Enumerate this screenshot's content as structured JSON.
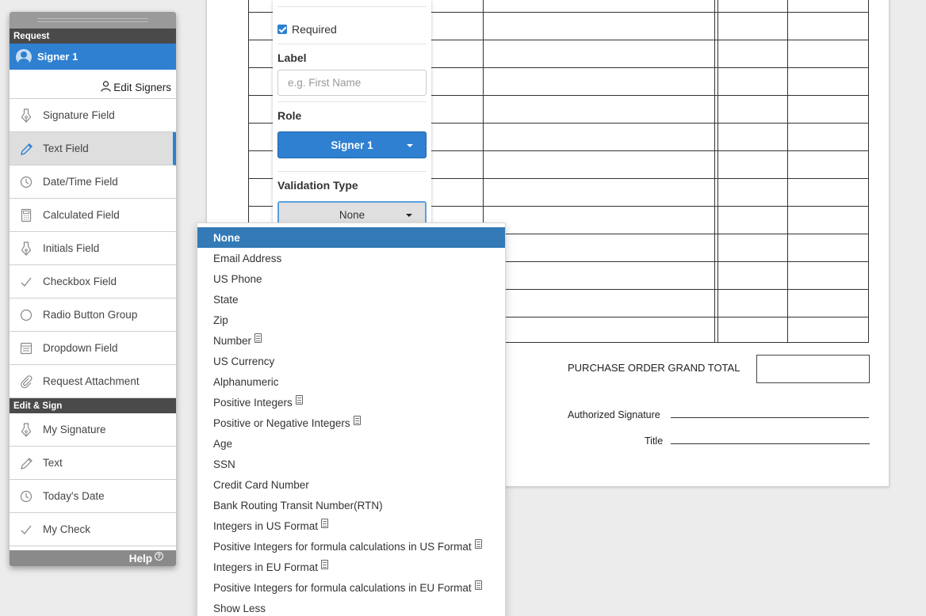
{
  "toolbar": {
    "sections": {
      "request": "Request",
      "edit_sign": "Edit & Sign"
    },
    "signer": "Signer 1",
    "edit_signers": "Edit Signers",
    "request_items": [
      {
        "label": "Signature Field",
        "icon": "pen-nib-icon"
      },
      {
        "label": "Text Field",
        "icon": "pencil-icon"
      },
      {
        "label": "Date/Time Field",
        "icon": "clock-icon"
      },
      {
        "label": "Calculated Field",
        "icon": "calculator-icon"
      },
      {
        "label": "Initials Field",
        "icon": "pen-nib-icon"
      },
      {
        "label": "Checkbox Field",
        "icon": "checkmark-icon"
      },
      {
        "label": "Radio Button Group",
        "icon": "radio-circle-icon"
      },
      {
        "label": "Dropdown Field",
        "icon": "dropdown-list-icon"
      },
      {
        "label": "Request Attachment",
        "icon": "paperclip-icon"
      }
    ],
    "edit_items": [
      {
        "label": "My Signature",
        "icon": "pen-nib-icon"
      },
      {
        "label": "Text",
        "icon": "pencil-icon"
      },
      {
        "label": "Today's Date",
        "icon": "clock-icon"
      },
      {
        "label": "My Check",
        "icon": "checkmark-icon"
      }
    ],
    "help": "Help",
    "active_item": "Text Field",
    "accent_color": "#2f80d1"
  },
  "properties": {
    "required_label": "Required",
    "required_checked": true,
    "label_heading": "Label",
    "label_placeholder": "e.g. First Name",
    "role_heading": "Role",
    "role_value": "Signer 1",
    "validation_heading": "Validation Type",
    "validation_value": "None"
  },
  "validation_options": [
    {
      "label": "None",
      "selected": true,
      "has_doc_icon": false
    },
    {
      "label": "Email Address",
      "has_doc_icon": false
    },
    {
      "label": "US Phone",
      "has_doc_icon": false
    },
    {
      "label": "State",
      "has_doc_icon": false
    },
    {
      "label": "Zip",
      "has_doc_icon": false
    },
    {
      "label": "Number",
      "has_doc_icon": true
    },
    {
      "label": "US Currency",
      "has_doc_icon": false
    },
    {
      "label": "Alphanumeric",
      "has_doc_icon": false
    },
    {
      "label": "Positive Integers",
      "has_doc_icon": true
    },
    {
      "label": "Positive or Negative Integers",
      "has_doc_icon": true
    },
    {
      "label": "Age",
      "has_doc_icon": false
    },
    {
      "label": "SSN",
      "has_doc_icon": false
    },
    {
      "label": "Credit Card Number",
      "has_doc_icon": false
    },
    {
      "label": "Bank Routing Transit Number(RTN)",
      "has_doc_icon": false
    },
    {
      "label": "Integers in US Format",
      "has_doc_icon": true
    },
    {
      "label": "Positive Integers for formula calculations in US Format",
      "has_doc_icon": true
    },
    {
      "label": "Integers in EU Format",
      "has_doc_icon": true
    },
    {
      "label": "Positive Integers for formula calculations in EU Format",
      "has_doc_icon": true
    },
    {
      "label": "Show Less",
      "has_doc_icon": false
    }
  ],
  "document": {
    "grand_total_label": "PURCHASE ORDER GRAND TOTAL",
    "authorized_signature_label": "Authorized Signature",
    "title_label": "Title"
  }
}
